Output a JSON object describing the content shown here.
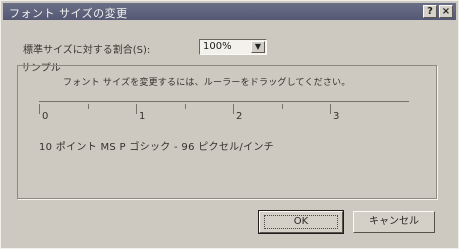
{
  "window": {
    "title": "フォント サイズの変更",
    "help_glyph": "?",
    "close_glyph": "×"
  },
  "scale": {
    "label": "標準サイズに対する割合(S):",
    "selected_value": "100%",
    "dropdown_icon": "chevron-down-icon"
  },
  "sample": {
    "group_label": "サンプル",
    "instruction": "フォント サイズを変更するには、ルーラーをドラッグしてください。",
    "ruler_ticks": [
      "0",
      "1",
      "2",
      "3"
    ],
    "font_info": "10 ポイント MS P ゴシック - 96 ピクセル/インチ"
  },
  "buttons": {
    "ok": "OK",
    "cancel": "キャンセル"
  }
}
